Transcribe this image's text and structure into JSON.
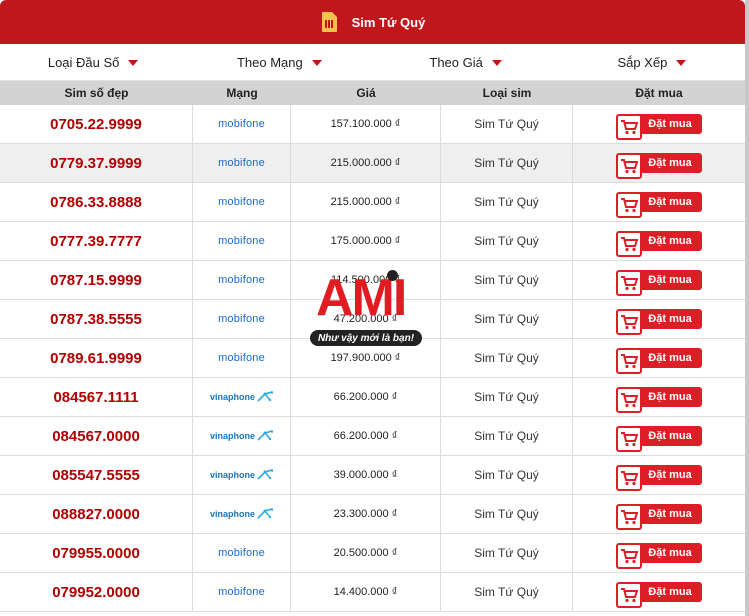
{
  "header": {
    "title": "Sim Tứ Quý",
    "icon": "sim-card-icon"
  },
  "filters": [
    "Loại Đầu Số",
    "Theo Mạng",
    "Theo Giá",
    "Sắp Xếp"
  ],
  "columns": [
    "Sim số đẹp",
    "Mạng",
    "Giá",
    "Loại sim",
    "Đặt mua"
  ],
  "rows": [
    {
      "number": "0705.22.9999",
      "network": "mobifone",
      "price": "157.100.000 ₫",
      "type": "Sim Tứ Quý",
      "buy": "Đặt mua"
    },
    {
      "number": "0779.37.9999",
      "network": "mobifone",
      "price": "215.000.000 ₫",
      "type": "Sim Tứ Quý",
      "buy": "Đặt mua"
    },
    {
      "number": "0786.33.8888",
      "network": "mobifone",
      "price": "215.000.000 ₫",
      "type": "Sim Tứ Quý",
      "buy": "Đặt mua"
    },
    {
      "number": "0777.39.7777",
      "network": "mobifone",
      "price": "175.000.000 ₫",
      "type": "Sim Tứ Quý",
      "buy": "Đặt mua"
    },
    {
      "number": "0787.15.9999",
      "network": "mobifone",
      "price": "114.500.000 ₫",
      "type": "Sim Tứ Quý",
      "buy": "Đặt mua"
    },
    {
      "number": "0787.38.5555",
      "network": "mobifone",
      "price": "47.200.000 ₫",
      "type": "Sim Tứ Quý",
      "buy": "Đặt mua"
    },
    {
      "number": "0789.61.9999",
      "network": "mobifone",
      "price": "197.900.000 ₫",
      "type": "Sim Tứ Quý",
      "buy": "Đặt mua"
    },
    {
      "number": "084567.1111",
      "network": "vinaphone",
      "price": "66.200.000 ₫",
      "type": "Sim Tứ Quý",
      "buy": "Đặt mua"
    },
    {
      "number": "084567.0000",
      "network": "vinaphone",
      "price": "66.200.000 ₫",
      "type": "Sim Tứ Quý",
      "buy": "Đặt mua"
    },
    {
      "number": "085547.5555",
      "network": "vinaphone",
      "price": "39.000.000 ₫",
      "type": "Sim Tứ Quý",
      "buy": "Đặt mua"
    },
    {
      "number": "088827.0000",
      "network": "vinaphone",
      "price": "23.300.000 ₫",
      "type": "Sim Tứ Quý",
      "buy": "Đặt mua"
    },
    {
      "number": "079955.0000",
      "network": "mobifone",
      "price": "20.500.000 ₫",
      "type": "Sim Tứ Quý",
      "buy": "Đặt mua"
    },
    {
      "number": "079952.0000",
      "network": "mobifone",
      "price": "14.400.000 ₫",
      "type": "Sim Tứ Quý",
      "buy": "Đặt mua"
    }
  ],
  "watermark": {
    "logo": "AMI",
    "slogan": "Như vậy mới là bạn!"
  },
  "colors": {
    "brand_red": "#c0171d",
    "number_red": "#b10000",
    "button_red": "#dc1f26",
    "mobifone_blue": "#1a69c7",
    "vinaphone_blue": "#1b75bc"
  }
}
